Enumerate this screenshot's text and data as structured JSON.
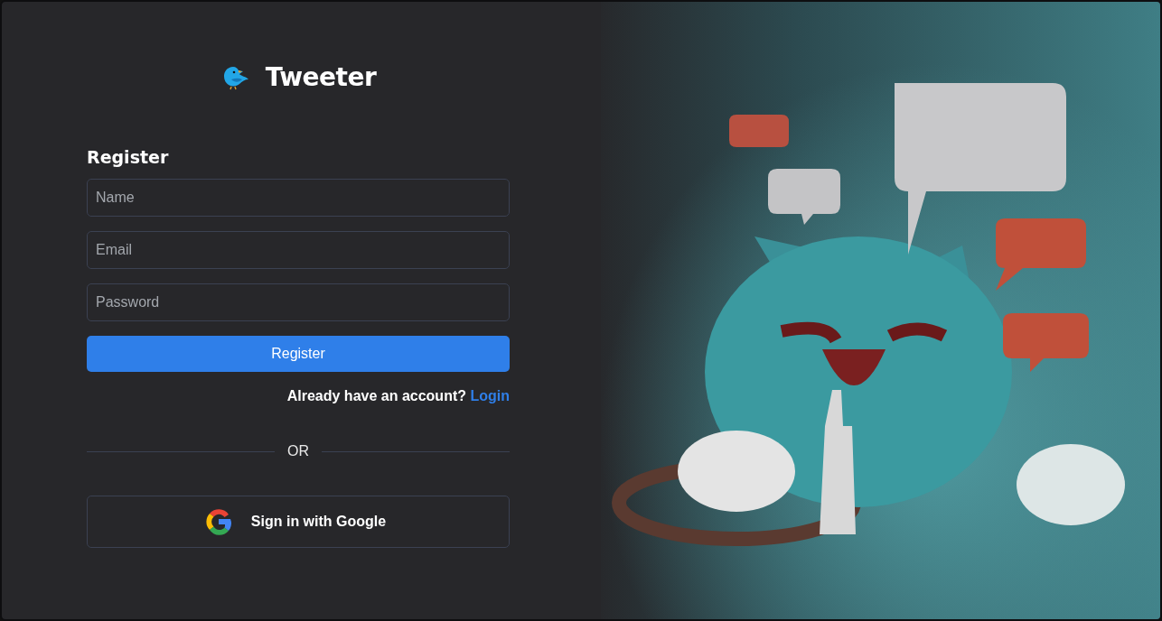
{
  "app": {
    "name": "Tweeter"
  },
  "form": {
    "title": "Register",
    "fields": [
      {
        "placeholder": "Name"
      },
      {
        "placeholder": "Email"
      },
      {
        "placeholder": "Password"
      }
    ],
    "submit": "Register",
    "prompt": {
      "text": "Already have an account?",
      "link": "Login"
    },
    "divider": "OR",
    "google_button": "Sign in with Google"
  }
}
